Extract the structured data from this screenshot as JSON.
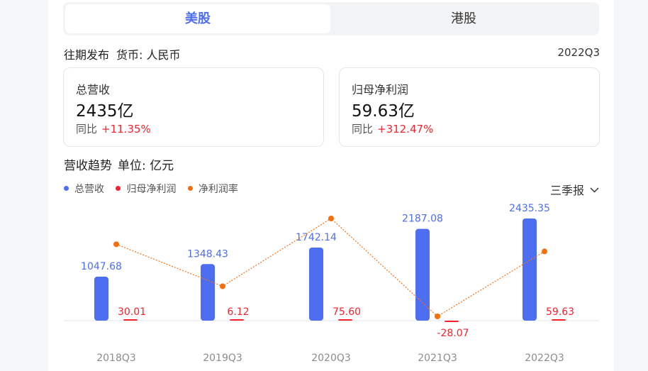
{
  "tabs": [
    {
      "label": "美股",
      "active": true
    },
    {
      "label": "港股",
      "active": false
    }
  ],
  "meta": {
    "history_label": "往期发布",
    "currency_label": "货币: 人民币",
    "period": "2022Q3"
  },
  "cards": [
    {
      "label": "总营收",
      "value": "2435亿",
      "yoy_label": "同比",
      "yoy_value": "+11.35%"
    },
    {
      "label": "归母净利润",
      "value": "59.63亿",
      "yoy_label": "同比",
      "yoy_value": "+312.47%"
    }
  ],
  "trend": {
    "title": "营收趋势",
    "unit": "单位: 亿元",
    "period_selector": "三季报"
  },
  "colors": {
    "accent": "#4e6ef2",
    "revenue": "#4e6ef2",
    "net_profit": "#f5222d",
    "margin": "#f56f0f"
  },
  "chart_data": {
    "type": "bar",
    "categories": [
      "2018Q3",
      "2019Q3",
      "2020Q3",
      "2021Q3",
      "2022Q3"
    ],
    "series": [
      {
        "name": "总营收",
        "type": "bar",
        "color": "#4e6ef2",
        "values": [
          1047.68,
          1348.43,
          1742.14,
          2187.08,
          2435.35
        ]
      },
      {
        "name": "归母净利润",
        "type": "bar",
        "color": "#f5222d",
        "values": [
          30.01,
          6.12,
          75.6,
          -28.07,
          59.63
        ]
      },
      {
        "name": "净利润率",
        "type": "line",
        "color": "#f56f0f",
        "values": [
          2.86,
          0.45,
          4.34,
          -1.28,
          2.45
        ]
      }
    ],
    "value_labels": [
      [
        "1047.68",
        "1348.43",
        "1742.14",
        "2187.08",
        "2435.35"
      ],
      [
        "30.01",
        "6.12",
        "75.60",
        "-28.07",
        "59.63"
      ]
    ],
    "legend": [
      "总营收",
      "归母净利润",
      "净利润率"
    ],
    "legend_position": "top-left",
    "grid": false
  }
}
